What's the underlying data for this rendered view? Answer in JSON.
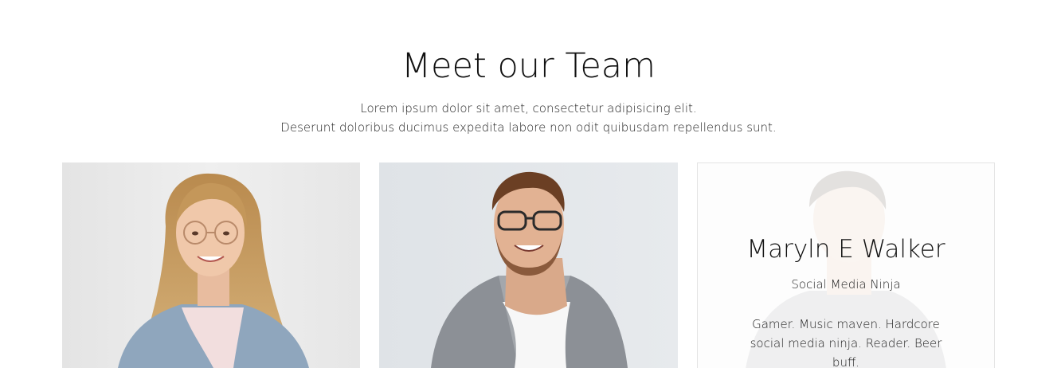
{
  "section": {
    "title": "Meet our Team",
    "subtitle_line1": "Lorem ipsum dolor sit amet, consectetur adipisicing elit.",
    "subtitle_line2": "Deserunt doloribus ducimus expedita labore non odit quibusdam repellendus sunt."
  },
  "team": {
    "members": [
      {
        "photo": "woman-portrait-photo"
      },
      {
        "photo": "man-with-glasses-portrait-photo"
      },
      {
        "photo": "man-portrait-photo",
        "name": "Maryln E Walker",
        "role": "Social Media Ninja",
        "bio": "Gamer. Music maven. Hardcore social media ninja. Reader. Beer buff."
      }
    ]
  }
}
